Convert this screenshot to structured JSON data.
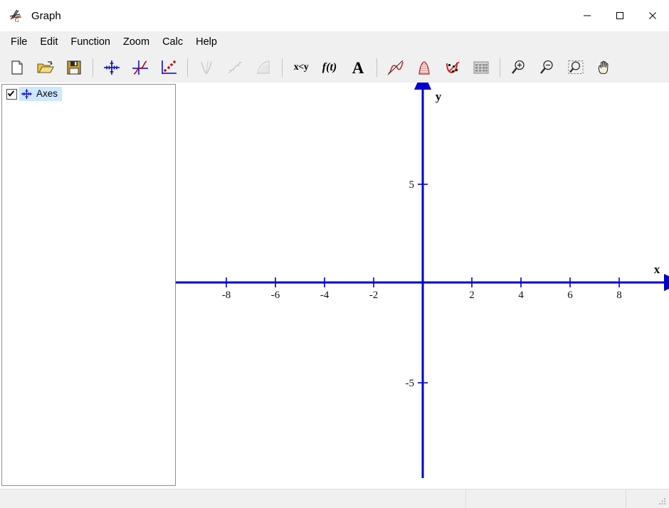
{
  "window": {
    "title": "Graph",
    "app_icon": "graph-app-icon",
    "controls": [
      {
        "name": "minimize",
        "glyph": "minimize-icon"
      },
      {
        "name": "maximize",
        "glyph": "maximize-icon"
      },
      {
        "name": "close",
        "glyph": "close-icon"
      }
    ]
  },
  "menubar": {
    "items": [
      {
        "label": "File"
      },
      {
        "label": "Edit"
      },
      {
        "label": "Function"
      },
      {
        "label": "Zoom"
      },
      {
        "label": "Calc"
      },
      {
        "label": "Help"
      }
    ]
  },
  "toolbar": {
    "groups": [
      {
        "buttons": [
          {
            "name": "new-file-button",
            "icon": "new-document-icon",
            "label": "New",
            "enabled": true
          },
          {
            "name": "open-file-button",
            "icon": "open-folder-icon",
            "label": "Open",
            "enabled": true
          },
          {
            "name": "save-file-button",
            "icon": "save-floppy-icon",
            "label": "Save",
            "enabled": true
          }
        ]
      },
      {
        "buttons": [
          {
            "name": "insert-axes-button",
            "icon": "axes-cross-icon",
            "label": "Insert axes",
            "enabled": true
          },
          {
            "name": "insert-function-button",
            "icon": "function-curve-icon",
            "label": "Insert function",
            "enabled": true
          },
          {
            "name": "insert-point-series-button",
            "icon": "point-series-icon",
            "label": "Insert point series",
            "enabled": true
          }
        ]
      },
      {
        "buttons": [
          {
            "name": "insert-tangent-button",
            "icon": "tangent-icon",
            "label": "Insert tangent",
            "enabled": false
          },
          {
            "name": "insert-trendline-button",
            "icon": "trendline-icon",
            "label": "Insert trendline",
            "enabled": false
          },
          {
            "name": "insert-shading-button",
            "icon": "shading-icon",
            "label": "Insert shading",
            "enabled": false
          }
        ]
      },
      {
        "buttons": [
          {
            "name": "insert-relation-button",
            "icon": "relation-xy-icon",
            "label": "x<y",
            "enabled": true
          },
          {
            "name": "insert-parametric-button",
            "icon": "parametric-ft-icon",
            "label": "f(t)",
            "enabled": true
          },
          {
            "name": "insert-label-button",
            "icon": "text-label-icon",
            "label": "A",
            "enabled": true
          }
        ]
      },
      {
        "buttons": [
          {
            "name": "evaluate-button",
            "icon": "evaluate-curve-icon",
            "label": "Evaluate",
            "enabled": true
          },
          {
            "name": "area-button",
            "icon": "area-shade-icon",
            "label": "Area",
            "enabled": true
          },
          {
            "name": "tangent-point-button",
            "icon": "tangent-point-icon",
            "label": "Tangent",
            "enabled": true
          },
          {
            "name": "table-button",
            "icon": "table-grid-icon",
            "label": "Table",
            "enabled": true
          }
        ]
      },
      {
        "buttons": [
          {
            "name": "zoom-in-button",
            "icon": "zoom-in-icon",
            "label": "Zoom in",
            "enabled": true
          },
          {
            "name": "zoom-out-button",
            "icon": "zoom-out-icon",
            "label": "Zoom out",
            "enabled": true
          },
          {
            "name": "zoom-window-button",
            "icon": "zoom-window-icon",
            "label": "Zoom window",
            "enabled": true
          },
          {
            "name": "pan-button",
            "icon": "pan-hand-icon",
            "label": "Pan",
            "enabled": true
          }
        ]
      }
    ]
  },
  "sidebar": {
    "items": [
      {
        "label": "Axes",
        "checked": true,
        "selected": true,
        "icon": "axes-cross-icon"
      }
    ]
  },
  "statusbar": {
    "panels": [
      "",
      "",
      ""
    ],
    "grip": "resize-grip-icon"
  },
  "chart_data": {
    "type": "line",
    "title": "",
    "xlabel": "x",
    "ylabel": "y",
    "xlim": [
      -9.8,
      9.75
    ],
    "ylim": [
      -10.0,
      10.1
    ],
    "x_ticks": [
      -8,
      -6,
      -4,
      -2,
      2,
      4,
      6,
      8
    ],
    "x_tick_labels": [
      "-8",
      "-6",
      "-4",
      "-2",
      "2",
      "4",
      "6",
      "8"
    ],
    "x_minor_ticks": [
      -9,
      -7,
      -5,
      -3,
      -1,
      1,
      3,
      5,
      7,
      9
    ],
    "y_ticks": [
      5,
      -5
    ],
    "y_tick_labels": [
      "5",
      "-5"
    ],
    "grid": false,
    "legend": false,
    "series": [],
    "axis_color": "#0000cc",
    "axis_style": "arrow-ended",
    "background": "#ffffff"
  }
}
